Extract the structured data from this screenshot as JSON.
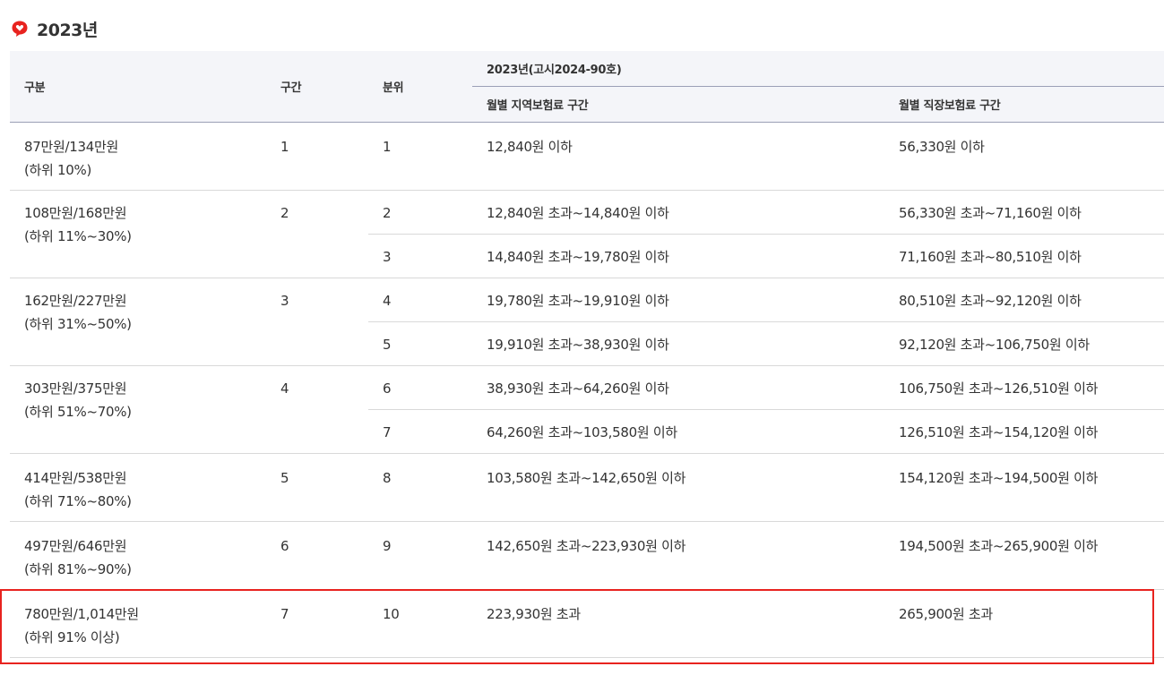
{
  "heading": {
    "title": "2023년",
    "icon": "heart-speech-bubble-icon",
    "icon_color": "#e8231f"
  },
  "table": {
    "headers": {
      "category": "구분",
      "section": "구간",
      "decile": "분위",
      "group": "2023년(고시2024-90호)",
      "regional": "월별 지역보험료 구간",
      "workplace": "월별 직장보험료 구간"
    },
    "groups": [
      {
        "category_line1": "87만원/134만원",
        "category_line2": "(하위 10%)",
        "section": "1",
        "rows": [
          {
            "decile": "1",
            "regional": "12,840원 이하",
            "workplace": "56,330원 이하"
          }
        ]
      },
      {
        "category_line1": "108만원/168만원",
        "category_line2": "(하위 11%~30%)",
        "section": "2",
        "rows": [
          {
            "decile": "2",
            "regional": "12,840원 초과~14,840원 이하",
            "workplace": "56,330원 초과~71,160원 이하"
          },
          {
            "decile": "3",
            "regional": "14,840원 초과~19,780원 이하",
            "workplace": "71,160원 초과~80,510원 이하"
          }
        ]
      },
      {
        "category_line1": "162만원/227만원",
        "category_line2": "(하위 31%~50%)",
        "section": "3",
        "rows": [
          {
            "decile": "4",
            "regional": "19,780원 초과~19,910원 이하",
            "workplace": "80,510원 초과~92,120원 이하"
          },
          {
            "decile": "5",
            "regional": "19,910원 초과~38,930원 이하",
            "workplace": "92,120원 초과~106,750원 이하"
          }
        ]
      },
      {
        "category_line1": "303만원/375만원",
        "category_line2": "(하위 51%~70%)",
        "section": "4",
        "rows": [
          {
            "decile": "6",
            "regional": "38,930원 초과~64,260원 이하",
            "workplace": "106,750원 초과~126,510원 이하"
          },
          {
            "decile": "7",
            "regional": "64,260원 초과~103,580원 이하",
            "workplace": "126,510원 초과~154,120원 이하"
          }
        ]
      },
      {
        "category_line1": "414만원/538만원",
        "category_line2": "(하위 71%~80%)",
        "section": "5",
        "rows": [
          {
            "decile": "8",
            "regional": "103,580원 초과~142,650원 이하",
            "workplace": "154,120원 초과~194,500원 이하"
          }
        ]
      },
      {
        "category_line1": "497만원/646만원",
        "category_line2": "(하위 81%~90%)",
        "section": "6",
        "rows": [
          {
            "decile": "9",
            "regional": "142,650원 초과~223,930원 이하",
            "workplace": "194,500원 초과~265,900원 이하"
          }
        ]
      },
      {
        "category_line1": "780만원/1,014만원",
        "category_line2": "(하위 91% 이상)",
        "section": "7",
        "rows": [
          {
            "decile": "10",
            "regional": "223,930원 초과",
            "workplace": "265,900원 초과"
          }
        ]
      }
    ],
    "highlight_color": "#e8231f"
  }
}
